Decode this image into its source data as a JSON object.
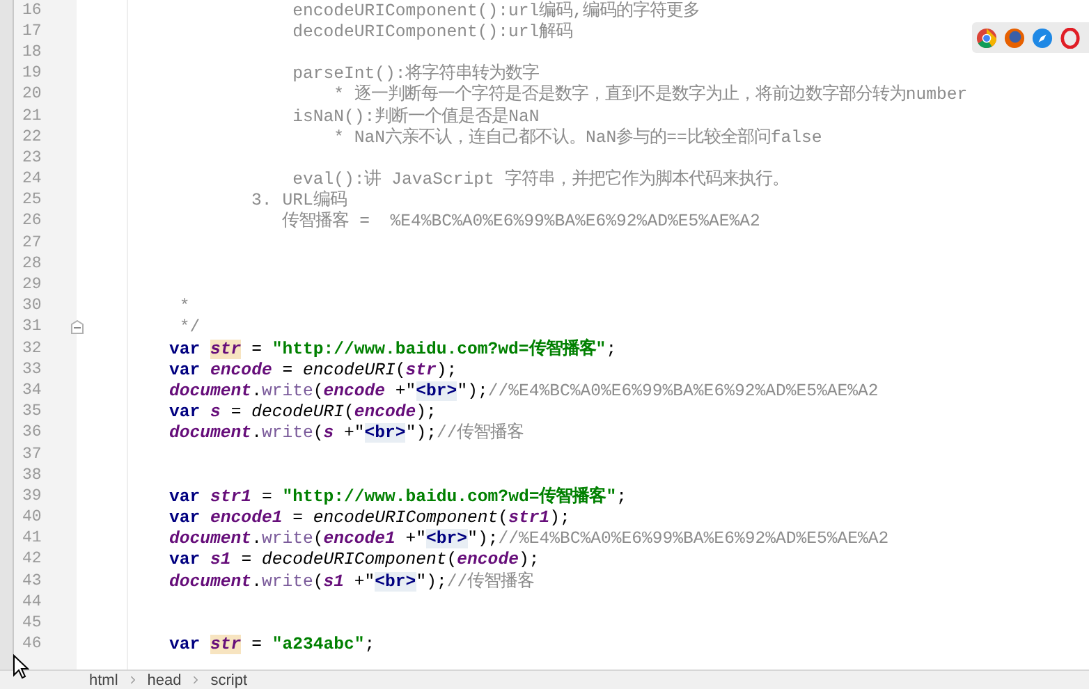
{
  "editor": {
    "lines": [
      {
        "number": "16",
        "tokens": [
          {
            "kind": "comment",
            "text": "                encodeURIComponent():url编码,编码的字符更多"
          }
        ]
      },
      {
        "number": "17",
        "tokens": [
          {
            "kind": "comment",
            "text": "                decodeURIComponent():url解码"
          }
        ]
      },
      {
        "number": "18"
      },
      {
        "number": "19",
        "tokens": [
          {
            "kind": "comment",
            "text": "                parseInt():将字符串转为数字"
          }
        ]
      },
      {
        "number": "20",
        "tokens": [
          {
            "kind": "comment",
            "text": "                    * 逐一判断每一个字符是否是数字，直到不是数字为止，将前边数字部分转为number"
          }
        ]
      },
      {
        "number": "21",
        "tokens": [
          {
            "kind": "comment",
            "text": "                isNaN():判断一个值是否是NaN"
          }
        ]
      },
      {
        "number": "22",
        "tokens": [
          {
            "kind": "comment",
            "text": "                    * NaN六亲不认，连自己都不认。NaN参与的==比较全部问false"
          }
        ]
      },
      {
        "number": "23"
      },
      {
        "number": "24",
        "tokens": [
          {
            "kind": "comment",
            "text": "                eval():讲 JavaScript 字符串，并把它作为脚本代码来执行。"
          }
        ]
      },
      {
        "number": "25",
        "tokens": [
          {
            "kind": "comment",
            "text": "            3. URL编码"
          }
        ]
      },
      {
        "number": "26",
        "tokens": [
          {
            "kind": "comment",
            "text": "               传智播客 =  %E4%BC%A0%E6%99%BA%E6%92%AD%E5%AE%A2"
          }
        ]
      },
      {
        "number": "27"
      },
      {
        "number": "28"
      },
      {
        "number": "29"
      },
      {
        "number": "30",
        "tokens": [
          {
            "kind": "comment",
            "text": "     *"
          }
        ]
      },
      {
        "number": "31",
        "folded": false,
        "tokens": [
          {
            "kind": "comment",
            "text": "     */"
          }
        ]
      },
      {
        "number": "32",
        "tokens": [
          {
            "kind": "keyword",
            "text": "    var "
          },
          {
            "kind": "variable",
            "text": "str",
            "highlighted": true
          },
          {
            "kind": "plain",
            "text": " = "
          },
          {
            "kind": "string",
            "text": "\"http://www.baidu.com?wd=传智播客\""
          },
          {
            "kind": "plain",
            "text": ";"
          }
        ]
      },
      {
        "number": "33",
        "tokens": [
          {
            "kind": "keyword",
            "text": "    var "
          },
          {
            "kind": "variable",
            "text": "encode"
          },
          {
            "kind": "plain",
            "text": " = "
          },
          {
            "kind": "function",
            "text": "encodeURI"
          },
          {
            "kind": "plain",
            "text": "("
          },
          {
            "kind": "variable",
            "text": "str"
          },
          {
            "kind": "plain",
            "text": ");"
          }
        ]
      },
      {
        "number": "34",
        "tokens": [
          {
            "kind": "object",
            "text": "    document"
          },
          {
            "kind": "plain",
            "text": "."
          },
          {
            "kind": "method",
            "text": "write"
          },
          {
            "kind": "plain",
            "text": "("
          },
          {
            "kind": "variable",
            "text": "encode"
          },
          {
            "kind": "plain",
            "text": " +\""
          },
          {
            "kind": "tag",
            "text": "<br>"
          },
          {
            "kind": "plain",
            "text": "\");"
          },
          {
            "kind": "comment",
            "text": "//%E4%BC%A0%E6%99%BA%E6%92%AD%E5%AE%A2"
          }
        ]
      },
      {
        "number": "35",
        "tokens": [
          {
            "kind": "keyword",
            "text": "    var "
          },
          {
            "kind": "variable",
            "text": "s"
          },
          {
            "kind": "plain",
            "text": " = "
          },
          {
            "kind": "function",
            "text": "decodeURI"
          },
          {
            "kind": "plain",
            "text": "("
          },
          {
            "kind": "variable",
            "text": "encode"
          },
          {
            "kind": "plain",
            "text": ");"
          }
        ]
      },
      {
        "number": "36",
        "tokens": [
          {
            "kind": "object",
            "text": "    document"
          },
          {
            "kind": "plain",
            "text": "."
          },
          {
            "kind": "method",
            "text": "write"
          },
          {
            "kind": "plain",
            "text": "("
          },
          {
            "kind": "variable",
            "text": "s"
          },
          {
            "kind": "plain",
            "text": " +\""
          },
          {
            "kind": "tag",
            "text": "<br>"
          },
          {
            "kind": "plain",
            "text": "\");"
          },
          {
            "kind": "comment",
            "text": "//传智播客"
          }
        ]
      },
      {
        "number": "37"
      },
      {
        "number": "38"
      },
      {
        "number": "39",
        "tokens": [
          {
            "kind": "keyword",
            "text": "    var "
          },
          {
            "kind": "variable",
            "text": "str1"
          },
          {
            "kind": "plain",
            "text": " = "
          },
          {
            "kind": "string",
            "text": "\"http://www.baidu.com?wd=传智播客\""
          },
          {
            "kind": "plain",
            "text": ";"
          }
        ]
      },
      {
        "number": "40",
        "tokens": [
          {
            "kind": "keyword",
            "text": "    var "
          },
          {
            "kind": "variable",
            "text": "encode1"
          },
          {
            "kind": "plain",
            "text": " = "
          },
          {
            "kind": "function",
            "text": "encodeURIComponent"
          },
          {
            "kind": "plain",
            "text": "("
          },
          {
            "kind": "variable",
            "text": "str1"
          },
          {
            "kind": "plain",
            "text": ");"
          }
        ]
      },
      {
        "number": "41",
        "tokens": [
          {
            "kind": "object",
            "text": "    document"
          },
          {
            "kind": "plain",
            "text": "."
          },
          {
            "kind": "method",
            "text": "write"
          },
          {
            "kind": "plain",
            "text": "("
          },
          {
            "kind": "variable",
            "text": "encode1"
          },
          {
            "kind": "plain",
            "text": " +\""
          },
          {
            "kind": "tag",
            "text": "<br>"
          },
          {
            "kind": "plain",
            "text": "\");"
          },
          {
            "kind": "comment",
            "text": "//%E4%BC%A0%E6%99%BA%E6%92%AD%E5%AE%A2"
          }
        ]
      },
      {
        "number": "42",
        "tokens": [
          {
            "kind": "keyword",
            "text": "    var "
          },
          {
            "kind": "variable",
            "text": "s1"
          },
          {
            "kind": "plain",
            "text": " = "
          },
          {
            "kind": "function",
            "text": "decodeURIComponent"
          },
          {
            "kind": "plain",
            "text": "("
          },
          {
            "kind": "variable",
            "text": "encode"
          },
          {
            "kind": "plain",
            "text": ");"
          }
        ]
      },
      {
        "number": "43",
        "tokens": [
          {
            "kind": "object",
            "text": "    document"
          },
          {
            "kind": "plain",
            "text": "."
          },
          {
            "kind": "method",
            "text": "write"
          },
          {
            "kind": "plain",
            "text": "("
          },
          {
            "kind": "variable",
            "text": "s1"
          },
          {
            "kind": "plain",
            "text": " +\""
          },
          {
            "kind": "tag",
            "text": "<br>"
          },
          {
            "kind": "plain",
            "text": "\");"
          },
          {
            "kind": "comment",
            "text": "//传智播客"
          }
        ]
      },
      {
        "number": "44"
      },
      {
        "number": "45"
      },
      {
        "number": "46",
        "tokens": [
          {
            "kind": "keyword",
            "text": "    var "
          },
          {
            "kind": "variable",
            "text": "str",
            "highlighted": true
          },
          {
            "kind": "plain",
            "text": " = "
          },
          {
            "kind": "string",
            "text": "\"a234abc\""
          },
          {
            "kind": "plain",
            "text": ";"
          }
        ]
      }
    ]
  },
  "breadcrumbs": [
    "html",
    "head",
    "script"
  ]
}
